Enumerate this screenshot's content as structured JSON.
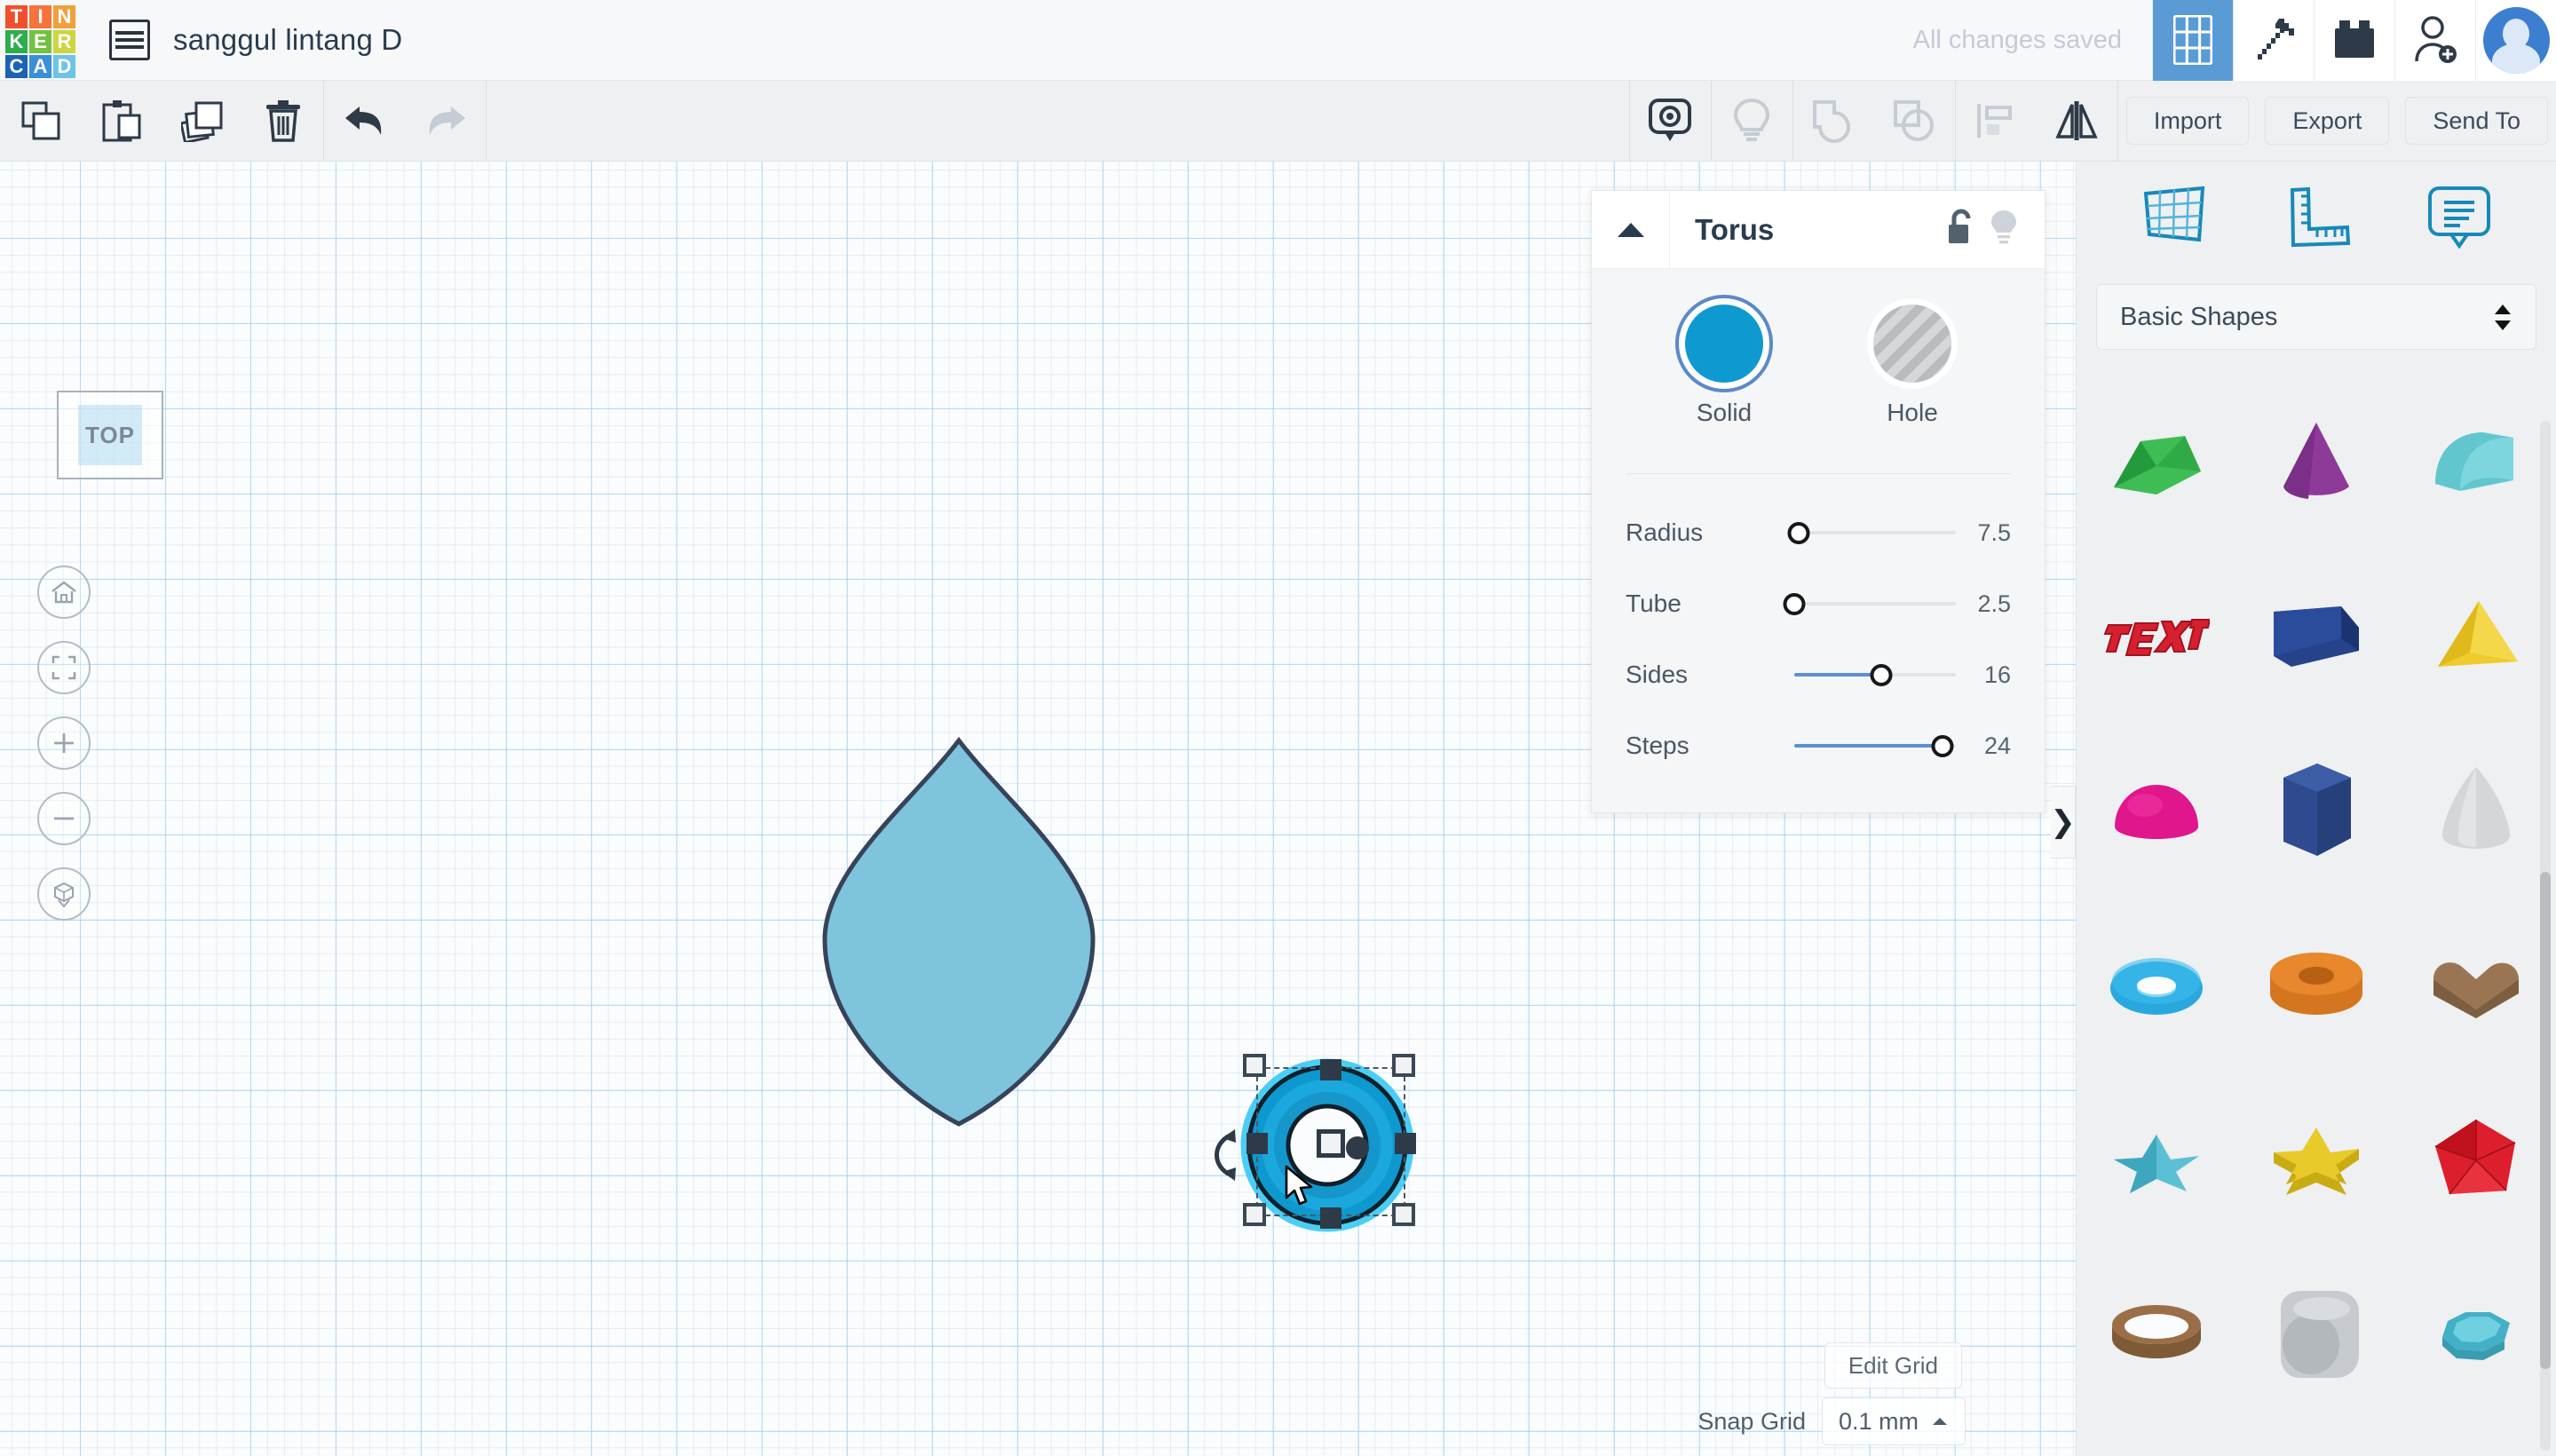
{
  "header": {
    "logo_tiles": [
      {
        "letter": "T",
        "color": "#f04f2e"
      },
      {
        "letter": "I",
        "color": "#f4743b"
      },
      {
        "letter": "N",
        "color": "#f2a03c"
      },
      {
        "letter": "K",
        "color": "#2ead4c"
      },
      {
        "letter": "E",
        "color": "#73c143"
      },
      {
        "letter": "R",
        "color": "#cdd63f"
      },
      {
        "letter": "C",
        "color": "#1d62b4"
      },
      {
        "letter": "A",
        "color": "#3b8fd4"
      },
      {
        "letter": "D",
        "color": "#6ec3e8"
      }
    ],
    "project_title": "sanggul lintang D",
    "save_status": "All changes saved",
    "icons": [
      {
        "name": "apps-grid-icon",
        "active": true
      },
      {
        "name": "minecraft-pickaxe-icon",
        "active": false
      },
      {
        "name": "lego-brick-icon",
        "active": false
      },
      {
        "name": "add-person-icon",
        "active": false
      }
    ],
    "accent_color": "#5b9bd5"
  },
  "toolbar": {
    "left_icons": [
      "copy-icon",
      "paste-icon",
      "duplicate-icon",
      "delete-icon"
    ],
    "history_icons": [
      "undo-icon",
      "redo-icon"
    ],
    "right_icons": [
      "note-icon",
      "light-icon",
      "group-icon",
      "ungroup-icon",
      "align-icon",
      "mirror-icon"
    ],
    "import_label": "Import",
    "export_label": "Export",
    "send_to_label": "Send To"
  },
  "canvas": {
    "view_label": "TOP",
    "nav_icons": [
      "home-icon",
      "fit-view-icon",
      "zoom-in-icon",
      "zoom-out-icon",
      "ortho-view-icon"
    ],
    "edit_grid_label": "Edit Grid",
    "snap_grid_label": "Snap Grid",
    "snap_grid_value": "0.1 mm",
    "shape_fill": "#7dc4dc",
    "shape_stroke": "#36435a",
    "selected_shape_color": "#0e9ad0"
  },
  "inspector": {
    "title": "Torus",
    "lock_icon": "unlock-icon",
    "light_icon": "lightbulb-icon",
    "collapse_icon": "triangle-up-icon",
    "solid_label": "Solid",
    "hole_label": "Hole",
    "solid_color": "#0e9ad0",
    "selected_mode": "Solid",
    "params": [
      {
        "label": "Radius",
        "value": "7.5",
        "pct": 3
      },
      {
        "label": "Tube",
        "value": "2.5",
        "pct": 0
      },
      {
        "label": "Sides",
        "value": "16",
        "pct": 54
      },
      {
        "label": "Steps",
        "value": "24",
        "pct": 92
      }
    ]
  },
  "sidebar": {
    "top_icons": [
      "workplane-icon",
      "ruler-icon",
      "note-icon"
    ],
    "category_value": "Basic Shapes",
    "shapes": [
      {
        "name": "box-wedge",
        "color": "#34a94a"
      },
      {
        "name": "cone",
        "color": "#8e3a99"
      },
      {
        "name": "half-cylinder",
        "color": "#5cc0c9"
      },
      {
        "name": "text",
        "color": "#d6202f"
      },
      {
        "name": "box",
        "color": "#26428b"
      },
      {
        "name": "pyramid",
        "color": "#efcb2b"
      },
      {
        "name": "half-sphere",
        "color": "#e0168c"
      },
      {
        "name": "hex-prism",
        "color": "#2f4a8e"
      },
      {
        "name": "paraboloid",
        "color": "#c9cdd1"
      },
      {
        "name": "torus",
        "color": "#29a8dd"
      },
      {
        "name": "tube",
        "color": "#e8872b"
      },
      {
        "name": "heart",
        "color": "#9a7553"
      },
      {
        "name": "star-3d",
        "color": "#5cc0d4"
      },
      {
        "name": "star-prism",
        "color": "#e8ca2b"
      },
      {
        "name": "polyhedron",
        "color": "#dd1f2d"
      },
      {
        "name": "ring",
        "color": "#9a6f47"
      },
      {
        "name": "rounded-cube",
        "color": "#b9bdc1"
      },
      {
        "name": "gem-octagon",
        "color": "#5cc0d4"
      }
    ]
  },
  "panel_tab": {
    "icon": "chevron-right-icon",
    "label": "❯"
  }
}
